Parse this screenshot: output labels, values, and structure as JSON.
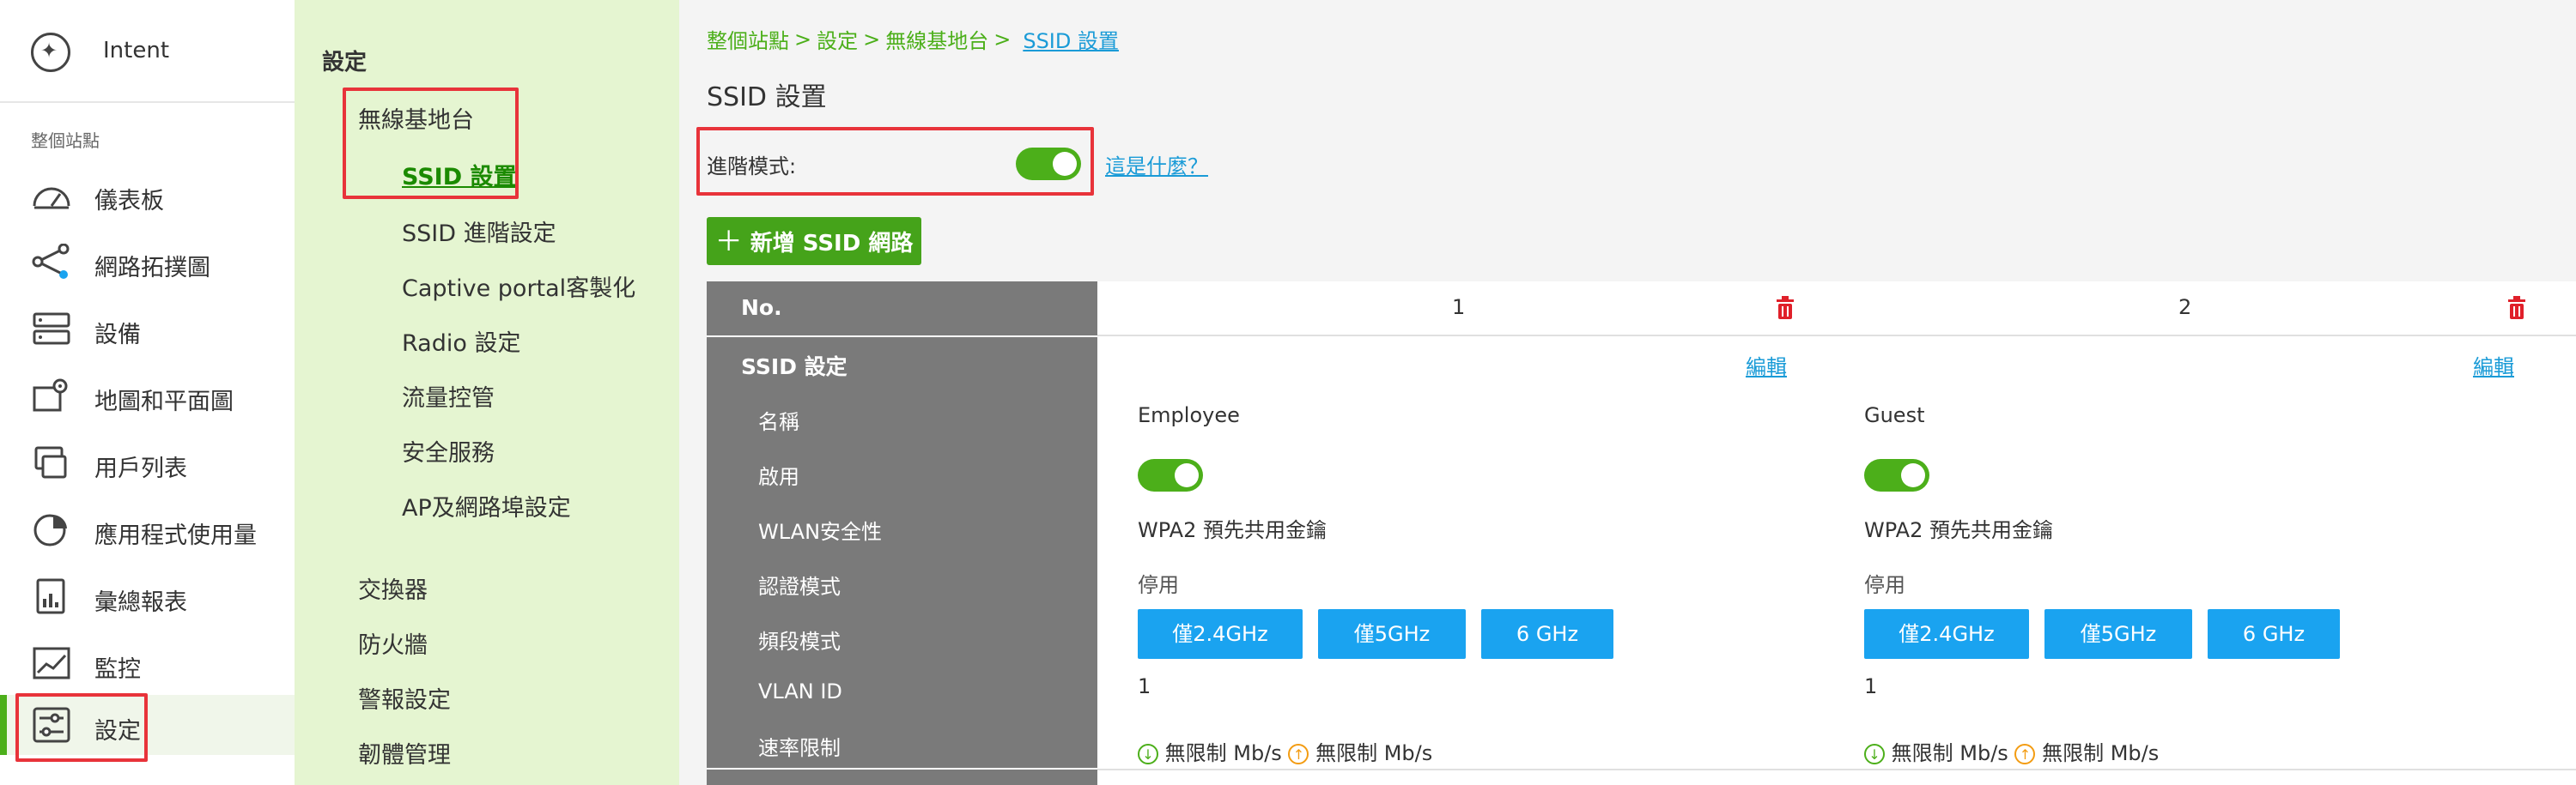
{
  "leftnav": {
    "intent_label": "Intent",
    "section_label": "整個站點",
    "items": [
      {
        "label": "儀表板",
        "icon": "dashboard-icon"
      },
      {
        "label": "網路拓撲圖",
        "icon": "topology-icon"
      },
      {
        "label": "設備",
        "icon": "server-icon"
      },
      {
        "label": "地圖和平面圖",
        "icon": "map-pin-icon"
      },
      {
        "label": "用戶列表",
        "icon": "clients-icon"
      },
      {
        "label": "應用程式使用量",
        "icon": "pie-chart-icon"
      },
      {
        "label": "彙總報表",
        "icon": "report-icon"
      },
      {
        "label": "監控",
        "icon": "line-chart-icon"
      },
      {
        "label": "設定",
        "icon": "sliders-icon",
        "active": true
      }
    ]
  },
  "submenu": {
    "title": "設定",
    "group_wireless": "無線基地台",
    "wireless_items": [
      "SSID 設置",
      "SSID 進階設定",
      "Captive portal客製化",
      "Radio 設定",
      "流量控管",
      "安全服務",
      "AP及網路埠設定"
    ],
    "group_switch": "交換器",
    "group_firewall": "防火牆",
    "group_alert": "警報設定",
    "group_firmware": "韌體管理"
  },
  "breadcrumb": {
    "items": [
      "整個站點",
      "設定",
      "無線基地台"
    ],
    "separator": ">",
    "current": "SSID 設置"
  },
  "page": {
    "title": "SSID 設置",
    "advanced_mode_label": "進階模式:",
    "advanced_mode_on": true,
    "help_link": "這是什麼？",
    "add_button": "新增 SSID 網路"
  },
  "table": {
    "header_no": "No.",
    "section_ssid": "SSID 設定",
    "row_labels": [
      "名稱",
      "啟用",
      "WLAN安全性",
      "認證模式",
      "頻段模式",
      "VLAN ID",
      "速率限制"
    ],
    "edit_label": "編輯",
    "columns": [
      {
        "no": "1",
        "name": "Employee",
        "enabled": true,
        "security": "WPA2 預先共用金鑰",
        "auth": "停用",
        "bands": [
          "僅2.4GHz",
          "僅5GHz",
          "6 GHz"
        ],
        "vlan": "1",
        "rate_down": "無限制 Mb/s",
        "rate_up": "無限制 Mb/s"
      },
      {
        "no": "2",
        "name": "Guest",
        "enabled": true,
        "security": "WPA2 預先共用金鑰",
        "auth": "停用",
        "bands": [
          "僅2.4GHz",
          "僅5GHz",
          "6 GHz"
        ],
        "vlan": "1",
        "rate_down": "無限制 Mb/s",
        "rate_up": "無限制 Mb/s"
      }
    ]
  },
  "colors": {
    "accent_green": "#4caf1a",
    "submenu_bg": "#e5f5d1",
    "band_blue": "#1aa3f0",
    "highlight_red": "#e8333a",
    "delete_red": "#e0202a"
  }
}
